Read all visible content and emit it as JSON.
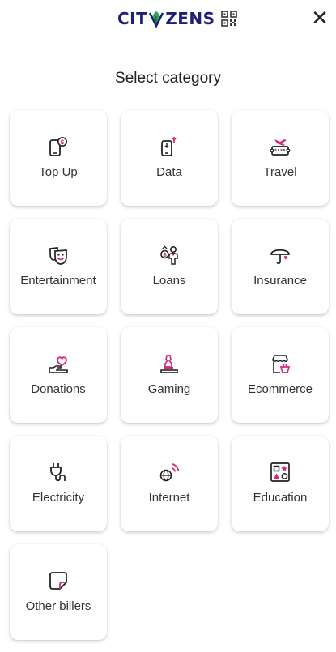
{
  "header": {
    "brand_left": "CIT",
    "brand_right": "ZENS",
    "logo_icon": "citizens-leaf-icon",
    "qr_icon": "qr-code-icon",
    "close_label": "✕"
  },
  "title": "Select category",
  "colors": {
    "accent": "#d6287e",
    "dark": "#222222",
    "brand": "#1f1f7a"
  },
  "categories": [
    {
      "label": "Top Up",
      "icon": "phone-dollar-icon"
    },
    {
      "label": "Data",
      "icon": "phone-data-icon"
    },
    {
      "label": "Travel",
      "icon": "travel-ticket-icon"
    },
    {
      "label": "Entertainment",
      "icon": "theater-masks-icon"
    },
    {
      "label": "Loans",
      "icon": "money-person-icon"
    },
    {
      "label": "Insurance",
      "icon": "umbrella-heart-icon"
    },
    {
      "label": "Donations",
      "icon": "hand-heart-icon"
    },
    {
      "label": "Gaming",
      "icon": "chess-piece-icon"
    },
    {
      "label": "Ecommerce",
      "icon": "shop-basket-icon"
    },
    {
      "label": "Electricity",
      "icon": "plug-icon"
    },
    {
      "label": "Internet",
      "icon": "globe-signal-icon"
    },
    {
      "label": "Education",
      "icon": "shapes-board-icon"
    },
    {
      "label": "Other billers",
      "icon": "note-icon"
    }
  ]
}
